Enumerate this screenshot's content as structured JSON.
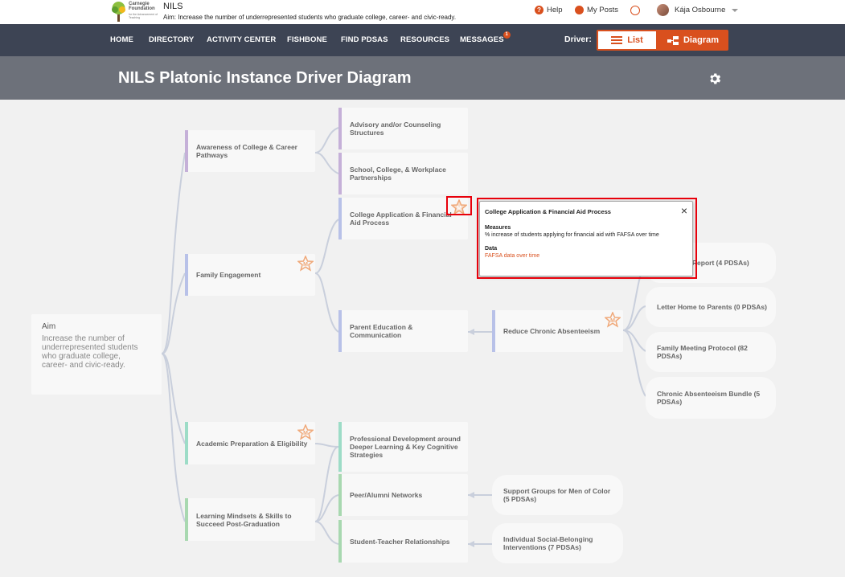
{
  "header": {
    "logo_lines": [
      "Carnegie",
      "Foundation",
      "for the Advancement of Teaching"
    ],
    "app_name": "NILS",
    "aim_line": "Aim:  Increase the number of underrepresented students who graduate college, career- and civic-ready.",
    "help_label": "Help",
    "help_icon": "?",
    "my_posts_label": "My Posts",
    "user_name": "Kája Osbourne"
  },
  "nav": {
    "items": [
      "HOME",
      "DIRECTORY",
      "ACTIVITY CENTER",
      "FISHBONE",
      "FIND PDSAS",
      "RESOURCES",
      "MESSAGES"
    ],
    "messages_badge": "1",
    "driver_label": "Driver:",
    "list_label": "List",
    "diagram_label": "Diagram"
  },
  "page": {
    "title": "NILS Platonic Instance Driver Diagram"
  },
  "aim": {
    "title": "Aim",
    "text": "Increase the number of underrepresented students who graduate college, career- and civic-ready."
  },
  "primary_drivers": [
    {
      "label": "Awareness of College & Career Pathways",
      "color": "#c5b0d8"
    },
    {
      "label": "Family Engagement",
      "color": "#b8c1e8"
    },
    {
      "label": "Academic Preparation & Eligibility",
      "color": "#9ddcc7"
    },
    {
      "label": "Learning Mindsets & Skills to Succeed Post-Graduation",
      "color": "#a8d8b0"
    }
  ],
  "secondary_drivers": [
    {
      "label": "Advisory and/or Counseling Structures",
      "color": "#c5b0d8"
    },
    {
      "label": "School, College, & Workplace Partnerships",
      "color": "#c5b0d8"
    },
    {
      "label": "College Application & Financial Aid Process",
      "color": "#b8c1e8"
    },
    {
      "label": "Parent Education & Communication",
      "color": "#b8c1e8"
    },
    {
      "label": "Reduce Chronic Absenteeism",
      "color": "#b8c1e8"
    },
    {
      "label": "Professional Development around Deeper Learning & Key Cognitive Strategies",
      "color": "#9ddcc7"
    },
    {
      "label": "Peer/Alumni Networks",
      "color": "#a8d8b0"
    },
    {
      "label": "Student-Teacher Relationships",
      "color": "#a8d8b0"
    }
  ],
  "change_ideas": [
    "ta Report (4 PDSAs)",
    "Letter Home to Parents (0 PDSAs)",
    "Family Meeting Protocol (82 PDSAs)",
    "Chronic Absenteeism Bundle (5 PDSAs)",
    "Support Groups for Men of Color (5 PDSAs)",
    "Individual Social-Belonging Interventions (7 PDSAs)"
  ],
  "measure_badge": "M",
  "popup": {
    "title": "College Application & Financial Aid Process",
    "measures_heading": "Measures",
    "measures_text": "% increase of students applying for financial aid with FAFSA over time",
    "data_heading": "Data",
    "data_link": "FAFSA data over time",
    "close": "×"
  },
  "colors": {
    "accent": "#d9501e",
    "nav_bg": "#3d4454",
    "title_bg": "#6d717a",
    "highlight": "#e8000b"
  }
}
